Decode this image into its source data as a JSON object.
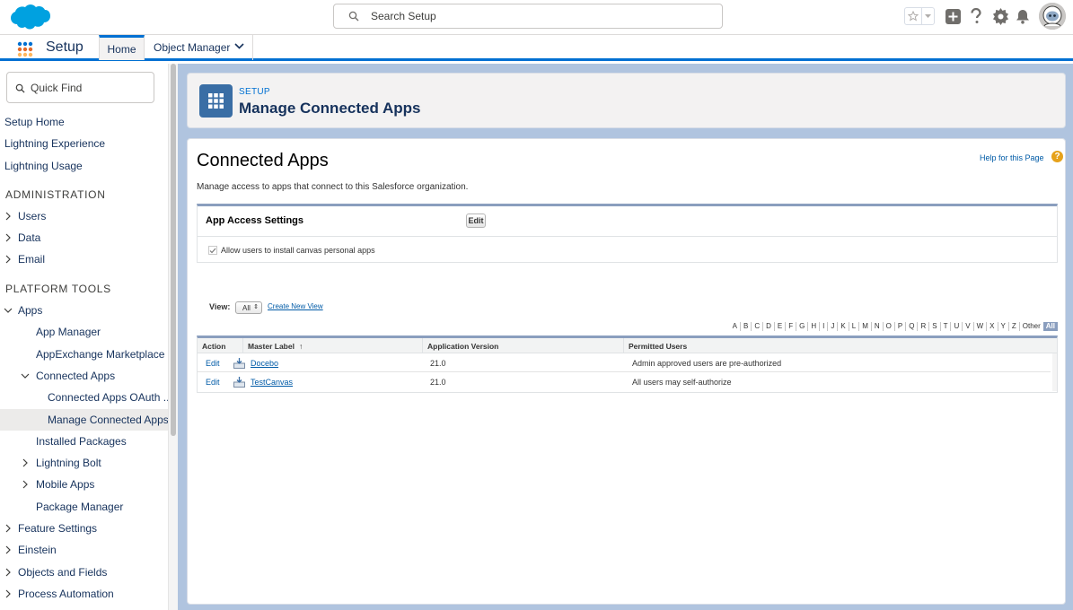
{
  "header": {
    "search_placeholder": "Search Setup"
  },
  "context_bar": {
    "app_name": "Setup",
    "tabs": [
      {
        "label": "Home"
      },
      {
        "label": "Object Manager"
      }
    ]
  },
  "sidebar": {
    "quick_find_placeholder": "Quick Find",
    "top_links": [
      "Setup Home",
      "Lightning Experience",
      "Lightning Usage"
    ],
    "sections": {
      "administration": "ADMINISTRATION",
      "platform_tools": "PLATFORM TOOLS"
    },
    "admin_items": [
      "Users",
      "Data",
      "Email"
    ],
    "apps": {
      "label": "Apps",
      "children": [
        "App Manager",
        "AppExchange Marketplace"
      ],
      "connected_apps": {
        "label": "Connected Apps",
        "children": [
          "Connected Apps OAuth ...",
          "Manage Connected Apps"
        ]
      },
      "more_children": [
        "Installed Packages",
        "Lightning Bolt",
        "Mobile Apps",
        "Package Manager"
      ]
    },
    "platform_items": [
      "Feature Settings",
      "Einstein",
      "Objects and Fields",
      "Process Automation"
    ]
  },
  "page_header": {
    "eyebrow": "SETUP",
    "title": "Manage Connected Apps"
  },
  "content": {
    "title": "Connected Apps",
    "help_link": "Help for this Page",
    "help_icon": "?",
    "description": "Manage access to apps that connect to this Salesforce organization.",
    "app_access": {
      "title": "App Access Settings",
      "edit_label": "Edit",
      "checkbox_label": "Allow users to install canvas personal apps",
      "checked": true
    },
    "view": {
      "label": "View:",
      "selected": "All",
      "create_link": "Create New View"
    },
    "alpha": [
      "A",
      "B",
      "C",
      "D",
      "E",
      "F",
      "G",
      "H",
      "I",
      "J",
      "K",
      "L",
      "M",
      "N",
      "O",
      "P",
      "Q",
      "R",
      "S",
      "T",
      "U",
      "V",
      "W",
      "X",
      "Y",
      "Z",
      "Other",
      "All"
    ],
    "alpha_active": "All",
    "table": {
      "columns": [
        "Action",
        "Master Label",
        "Application Version",
        "Permitted Users"
      ],
      "sort_indicator": "↑",
      "rows": [
        {
          "action": "Edit",
          "label": "Docebo",
          "version": "21.0",
          "permitted": "Admin approved users are pre-authorized"
        },
        {
          "action": "Edit",
          "label": "TestCanvas",
          "version": "21.0",
          "permitted": "All users may self-authorize"
        }
      ]
    }
  },
  "colors": {
    "accent": "#0070d2",
    "brand_blue": "#00a1e0",
    "header_icon_bg": "#3a6ea5",
    "help_icon_bg": "#e6a21b"
  }
}
